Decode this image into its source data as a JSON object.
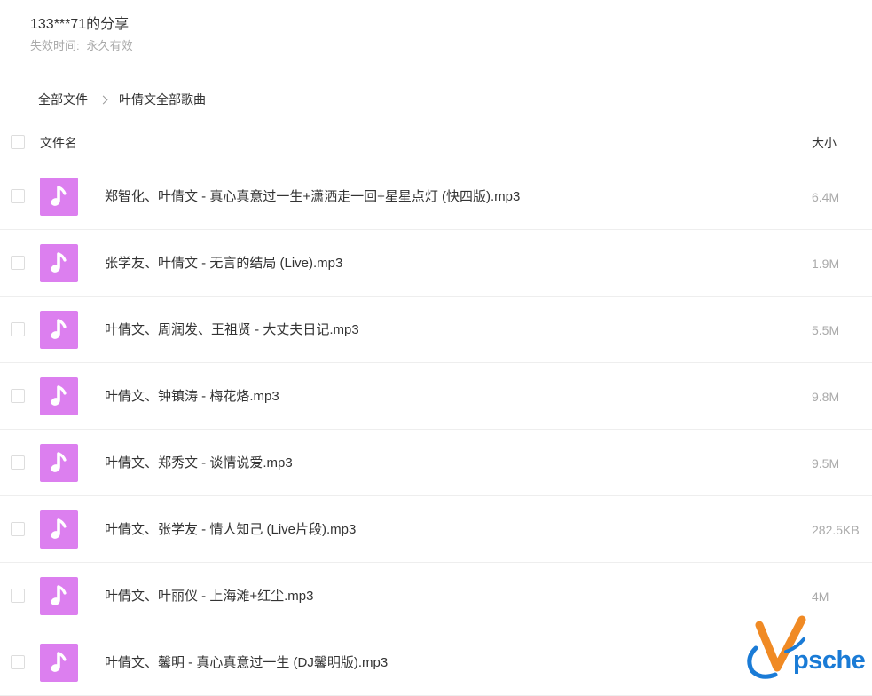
{
  "share": {
    "title": "133***71的分享",
    "expire_label": "失效时间:",
    "expire_value": "永久有效"
  },
  "breadcrumb": {
    "root": "全部文件",
    "current": "叶倩文全部歌曲"
  },
  "list_header": {
    "name_col": "文件名",
    "size_col": "大小"
  },
  "files": [
    {
      "name": "郑智化、叶倩文 - 真心真意过一生+潇洒走一回+星星点灯 (快四版).mp3",
      "size": "6.4M",
      "icon": "music-note-icon"
    },
    {
      "name": "张学友、叶倩文 - 无言的结局 (Live).mp3",
      "size": "1.9M",
      "icon": "music-note-icon"
    },
    {
      "name": "叶倩文、周润发、王祖贤 - 大丈夫日记.mp3",
      "size": "5.5M",
      "icon": "music-note-icon"
    },
    {
      "name": "叶倩文、钟镇涛 - 梅花烙.mp3",
      "size": "9.8M",
      "icon": "music-note-icon"
    },
    {
      "name": "叶倩文、郑秀文 - 谈情说爱.mp3",
      "size": "9.5M",
      "icon": "music-note-icon"
    },
    {
      "name": "叶倩文、张学友 - 情人知己 (Live片段).mp3",
      "size": "282.5KB",
      "icon": "music-note-icon"
    },
    {
      "name": "叶倩文、叶丽仪 - 上海滩+红尘.mp3",
      "size": "4M",
      "icon": "music-note-icon"
    },
    {
      "name": "叶倩文、馨明 - 真心真意过一生 (DJ馨明版).mp3",
      "size": "",
      "icon": "music-note-icon"
    }
  ],
  "watermark": {
    "text": "psche"
  },
  "colors": {
    "icon_bg": "#dc7fef",
    "muted_text": "#aaaaaa",
    "divider": "#eeeeee",
    "watermark_blue": "#1a7bd6",
    "watermark_orange": "#f08a24"
  }
}
